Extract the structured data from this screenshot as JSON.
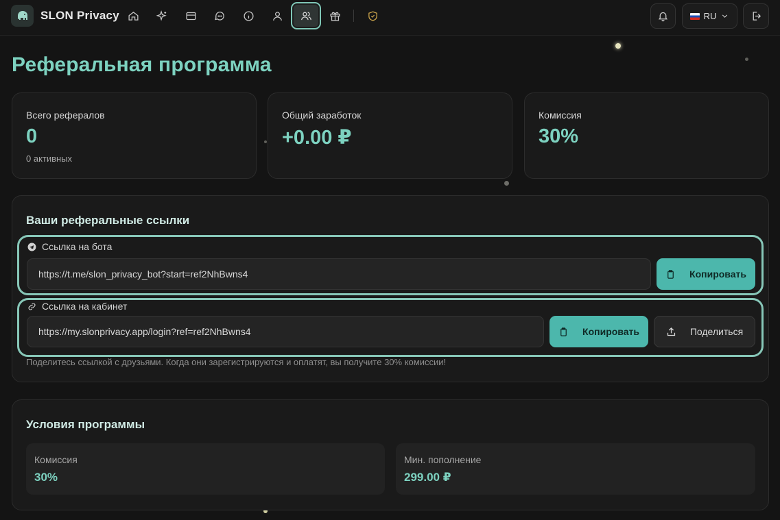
{
  "app": {
    "brand": "SLON Privacy"
  },
  "nav": {
    "items": [
      {
        "icon": "home-icon"
      },
      {
        "icon": "sparkles-icon"
      },
      {
        "icon": "credit-card-icon"
      },
      {
        "icon": "chat-icon"
      },
      {
        "icon": "info-icon"
      },
      {
        "icon": "user-icon"
      },
      {
        "icon": "users-icon",
        "active": true
      },
      {
        "icon": "gift-icon"
      },
      {
        "icon": "shield-icon"
      }
    ],
    "language": "RU"
  },
  "page": {
    "title": "Реферальная программа"
  },
  "stats": {
    "total_label": "Всего рефералов",
    "total_value": "0",
    "total_sub": "0 активных",
    "earnings_label": "Общий заработок",
    "earnings_value": "+0.00 ₽",
    "commission_label": "Комиссия",
    "commission_value": "30%"
  },
  "links": {
    "title": "Ваши реферальные ссылки",
    "bot_label": "Ссылка на бота",
    "bot_url": "https://t.me/slon_privacy_bot?start=ref2NhBwns4",
    "bot_copy": "Копировать",
    "cabinet_label": "Ссылка на кабинет",
    "cabinet_url": "https://my.slonprivacy.app/login?ref=ref2NhBwns4",
    "cabinet_copy": "Копировать",
    "share": "Поделиться",
    "hint": "Поделитесь ссылкой с друзьями. Когда они зарегистрируются и оплатят, вы получите 30% комиссии!"
  },
  "conditions": {
    "title": "Условия программы",
    "commission_label": "Комиссия",
    "commission_value": "30%",
    "min_topup_label": "Мин. пополнение",
    "min_topup_value": "299.00 ₽"
  },
  "colors": {
    "accent": "#7dd2c0",
    "button": "#4cb7ac",
    "highlight": "#87c7b8",
    "background": "#141414"
  }
}
